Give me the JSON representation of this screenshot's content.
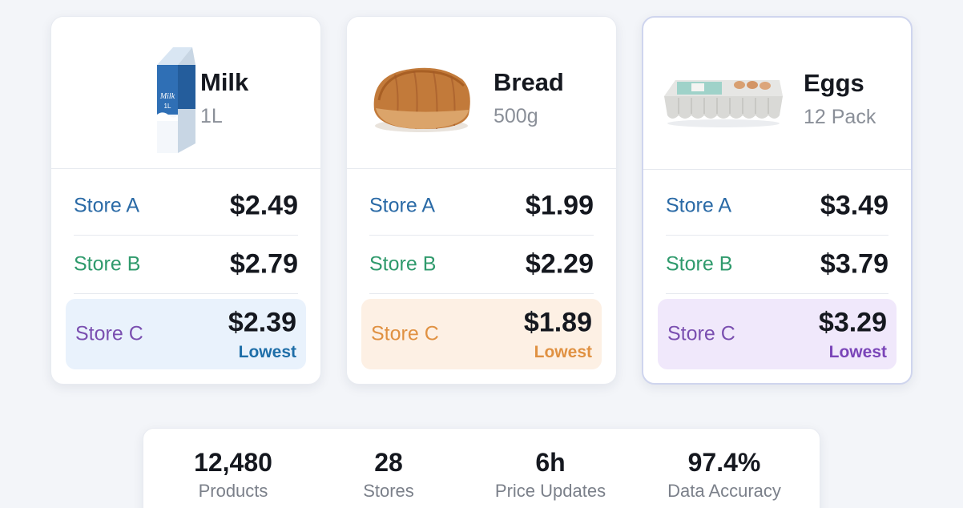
{
  "products": [
    {
      "name": "Milk",
      "size": "1L",
      "icon": "milk-carton-icon",
      "carton_text": "Milk 1L",
      "stores": [
        {
          "label": "Store A",
          "price": "$2.49"
        },
        {
          "label": "Store B",
          "price": "$2.79"
        },
        {
          "label": "Store C",
          "price": "$2.39",
          "tag": "Lowest"
        }
      ],
      "accent": "#1e6ea8",
      "highlight_bg": "#e9f2fc"
    },
    {
      "name": "Bread",
      "size": "500g",
      "icon": "bread-loaf-icon",
      "stores": [
        {
          "label": "Store A",
          "price": "$1.99"
        },
        {
          "label": "Store B",
          "price": "$2.29"
        },
        {
          "label": "Store C",
          "price": "$1.89",
          "tag": "Lowest"
        }
      ],
      "accent": "#e09142",
      "highlight_bg": "#fdf0e4"
    },
    {
      "name": "Eggs",
      "size": "12 Pack",
      "icon": "egg-carton-icon",
      "stores": [
        {
          "label": "Store A",
          "price": "$3.49"
        },
        {
          "label": "Store B",
          "price": "$3.79"
        },
        {
          "label": "Store C",
          "price": "$3.29",
          "tag": "Lowest"
        }
      ],
      "accent": "#7a45b8",
      "highlight_bg": "#f0e8fb"
    }
  ],
  "store_colors": {
    "store_a": "#2a6aa6",
    "store_b": "#2f9a6c",
    "store_c_milk": "#7a4fb0",
    "store_c_bread": "#e09142",
    "store_c_eggs": "#7a4fb0"
  },
  "stats": [
    {
      "value": "12,480",
      "label": "Products"
    },
    {
      "value": "28",
      "label": "Stores"
    },
    {
      "value": "6h",
      "label": "Price Updates"
    },
    {
      "value": "97.4%",
      "label": "Data Accuracy"
    }
  ]
}
